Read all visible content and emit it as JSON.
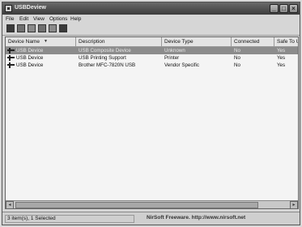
{
  "window": {
    "title": "USBDeview",
    "buttons": {
      "minimize": "_",
      "maximize": "□",
      "close": "×"
    }
  },
  "menu": [
    "File",
    "Edit",
    "View",
    "Options",
    "Help"
  ],
  "toolbar": {
    "icons": [
      "save-icon",
      "properties-icon",
      "copy-icon",
      "find-icon",
      "refresh-icon",
      "exit-icon"
    ]
  },
  "table": {
    "columns": [
      "Device Name",
      "Description",
      "Device Type",
      "Connected",
      "Safe To Un"
    ],
    "rows": [
      {
        "name": "USB Device",
        "description": "USB Composite Device",
        "type": "Unknown",
        "connected": "No",
        "safe": "Yes",
        "selected": true
      },
      {
        "name": "USB Device",
        "description": "USB Printing Support",
        "type": "Printer",
        "connected": "No",
        "safe": "Yes",
        "selected": false
      },
      {
        "name": "USB Device",
        "description": "Brother MFC-7820N USB",
        "type": "Vendor Specific",
        "connected": "No",
        "safe": "Yes",
        "selected": false
      }
    ]
  },
  "scrollbar": {
    "left": "◂",
    "right": "▸"
  },
  "status": {
    "left": "3 item(s), 1 Selected",
    "right": "NirSoft Freeware.  http://www.nirsoft.net"
  }
}
